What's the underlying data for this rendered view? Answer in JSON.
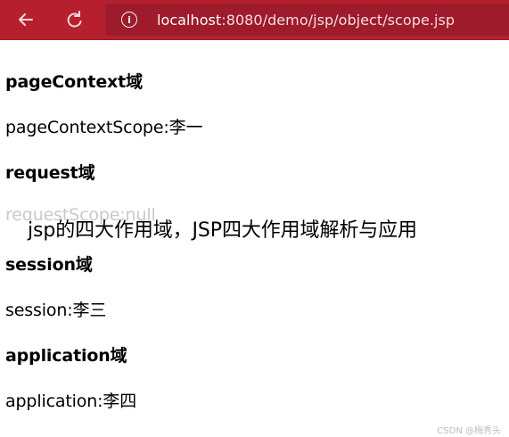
{
  "browser": {
    "url_host": "localhost",
    "url_path": ":8080/demo/jsp/object/scope.jsp"
  },
  "page": {
    "sections": [
      {
        "heading": "pageContext域",
        "value": "pageContextScope:李一"
      },
      {
        "heading": "request域",
        "value": "requestScope:null"
      },
      {
        "heading": "session域",
        "value": "session:李三"
      },
      {
        "heading": "application域",
        "value": "application:李四"
      }
    ],
    "overlay_title": "jsp的四大作用域，JSP四大作用域解析与应用",
    "watermark": "CSDN @梅秀头"
  }
}
